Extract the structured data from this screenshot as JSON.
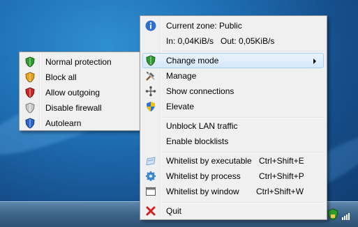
{
  "main_menu": {
    "zone_text": "Current zone: Public",
    "traffic_text": "In: 0,04KiB/s   Out: 0,05KiB/s",
    "change_mode_label": "Change mode",
    "manage_label": "Manage",
    "show_connections_label": "Show connections",
    "elevate_label": "Elevate",
    "unblock_lan_label": "Unblock LAN traffic",
    "enable_blocklists_label": "Enable blocklists",
    "whitelist_executable_label": "Whitelist by executable",
    "whitelist_executable_shortcut": "Ctrl+Shift+E",
    "whitelist_process_label": "Whitelist by process",
    "whitelist_process_shortcut": "Ctrl+Shift+P",
    "whitelist_window_label": "Whitelist by window",
    "whitelist_window_shortcut": "Ctrl+Shift+W",
    "quit_label": "Quit"
  },
  "mode_submenu": {
    "items": [
      {
        "label": "Normal protection",
        "icon": "shield-green-icon",
        "color": "#2e9b2e"
      },
      {
        "label": "Block all",
        "icon": "shield-orange-icon",
        "color": "#e6a21c"
      },
      {
        "label": "Allow outgoing",
        "icon": "shield-red-icon",
        "color": "#c62828"
      },
      {
        "label": "Disable firewall",
        "icon": "shield-gray-icon",
        "color": "#b5b5b5"
      },
      {
        "label": "Autolearn",
        "icon": "shield-blue-icon",
        "color": "#2a63c9"
      }
    ]
  },
  "colors": {
    "menu_bg": "#f0f0f0",
    "hover_bg": "#d6e8fb",
    "hover_border": "#a8d2f5"
  }
}
